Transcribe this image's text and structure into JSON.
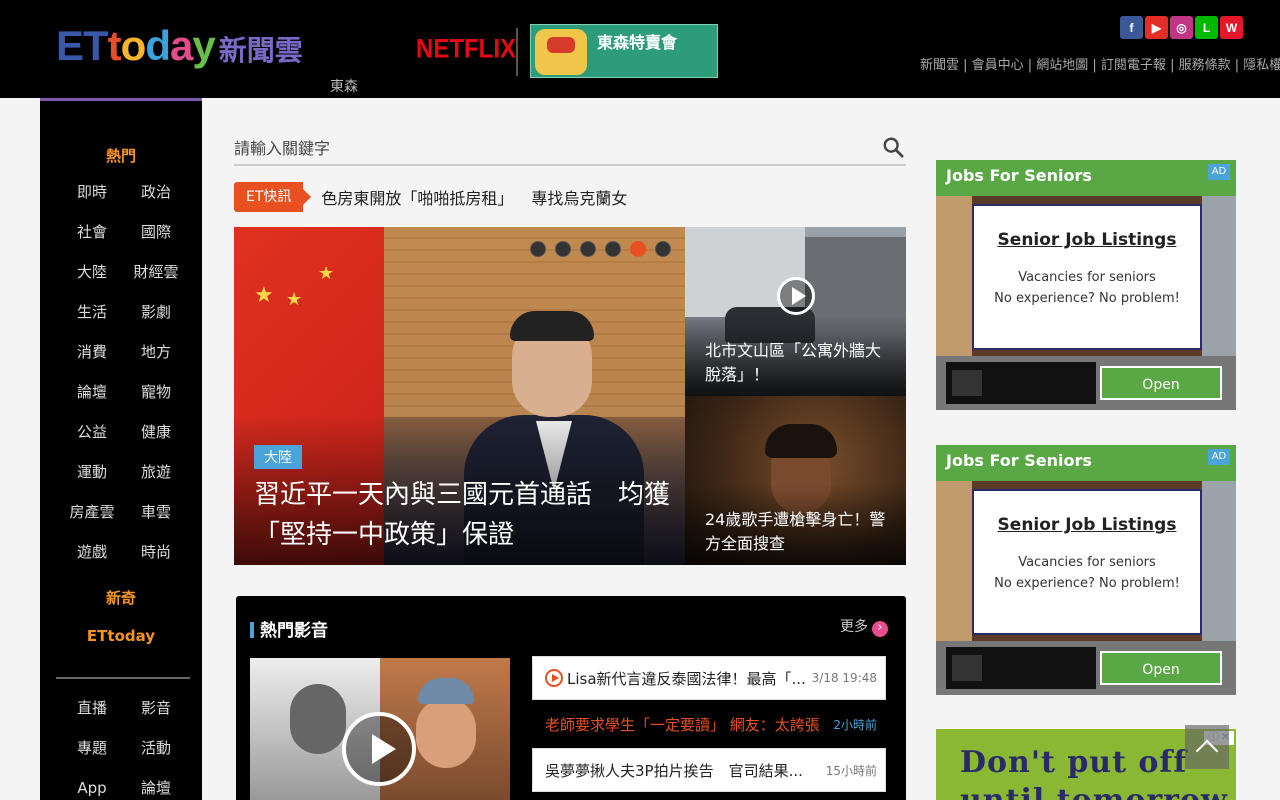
{
  "header": {
    "logo_et": "ET",
    "logo_today": [
      "t",
      "o",
      "d",
      "a",
      "y"
    ],
    "logo_cloud": "新聞雲",
    "logo_sub": "東森",
    "partner": "NETFLIX",
    "event_banner": "東森特賣會",
    "social": [
      {
        "icon": "facebook-icon",
        "glyph": "f",
        "color": "#3b5998"
      },
      {
        "icon": "youtube-icon",
        "glyph": "▶",
        "color": "#e52d27"
      },
      {
        "icon": "instagram-icon",
        "glyph": "◎",
        "color": "#c13584"
      },
      {
        "icon": "line-icon",
        "glyph": "L",
        "color": "#00b900"
      },
      {
        "icon": "weibo-icon",
        "glyph": "W",
        "color": "#e6162d"
      }
    ],
    "links": "新聞雲 | 會員中心 | 網站地圖 | 訂閱電子報 | 服務條款 | 隱私權政策"
  },
  "sidebar": {
    "hot": "熱門",
    "categories": [
      "即時",
      "政治",
      "社會",
      "國際",
      "大陸",
      "財經雲",
      "生活",
      "影劇",
      "消費",
      "地方",
      "論壇",
      "寵物",
      "公益",
      "健康",
      "運動",
      "旅遊",
      "房產雲",
      "車雲",
      "遊戲",
      "時尚"
    ],
    "special1": "新奇",
    "special2": "ETtoday",
    "categories2": [
      "直播",
      "影音",
      "專題",
      "活動",
      "App",
      "論壇"
    ]
  },
  "search": {
    "placeholder": "請輸入關鍵字"
  },
  "ticker": {
    "tag": "ET快訊",
    "items": [
      "色房東開放「啪啪抵房租」",
      "專找烏克蘭女"
    ]
  },
  "carousel": {
    "badge": "大陸",
    "headline": "習近平一天內與三國元首通話　均獲「堅持一中政策」保證",
    "dots": 6,
    "active_dot": 5
  },
  "side_stories": [
    {
      "caption": "北市文山區「公寓外牆大脫落」！"
    },
    {
      "caption": "24歲歌手遭槍擊身亡！警方全面搜查"
    }
  ],
  "video": {
    "title": "熱門影音",
    "more": "更多",
    "items": [
      {
        "title": "Lisa新代言違反泰國法律！最高「...",
        "time": "3/18 19:48",
        "dark": false
      },
      {
        "title": "老師要求學生「一定要讀」 網友：太誇張",
        "time": "2小時前",
        "dark": true
      },
      {
        "title": "吳夢夢揪人夫3P拍片挨告　官司結果...",
        "time": "15小時前",
        "dark": false
      }
    ]
  },
  "ads": [
    {
      "label": "Jobs For Seniors",
      "heading": "Senior Job Listings",
      "line1": "Vacancies for seniors",
      "line2": "No experience? No problem!",
      "button": "Open",
      "badge": "AD"
    },
    {
      "label": "Jobs For Seniors",
      "heading": "Senior Job Listings",
      "line1": "Vacancies for seniors",
      "line2": "No experience? No problem!",
      "button": "Open",
      "badge": "AD"
    }
  ],
  "ad3": {
    "line1": "Don't put off",
    "line2": "until tomorrow",
    "badge": "ⓘ ✕"
  }
}
